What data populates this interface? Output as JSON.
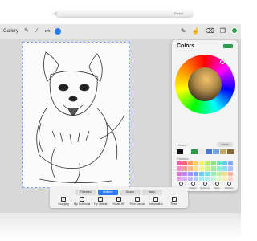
{
  "pencil": {
    "brand": "Pencil"
  },
  "topbar": {
    "gallery_label": "Gallery",
    "tools_left": [
      "wrench-icon",
      "magic-wand-icon",
      "selection-icon",
      "move-icon"
    ],
    "tools_right": [
      "brush-icon",
      "smudge-icon",
      "eraser-icon",
      "layers-icon"
    ],
    "current_color": "#2b9c4a"
  },
  "colors_panel": {
    "title": "Colors",
    "current_color": "#2b9c4a",
    "history_label": "History",
    "clear_label": "Clear",
    "history_colors": [
      "#111111",
      "#ffffff",
      "#2b9c4a",
      "#e8e8e8",
      "#4a78c9",
      "#6aa6e8",
      "#c8a860",
      "#8b6a3a"
    ],
    "palettes_label": "Palettes",
    "palette_colors": [
      "#ff5ca8",
      "#ff6b6b",
      "#ff9a5a",
      "#ffd15a",
      "#f5f55a",
      "#b8f05a",
      "#7ee87e",
      "#5ae8c0",
      "#5ad0f0",
      "#8aa8ff",
      "#ff8cc6",
      "#ff9a9a",
      "#ffb888",
      "#ffe088",
      "#f8f888",
      "#ccf488",
      "#a0f0a0",
      "#88f0d4",
      "#88e0f6",
      "#aabcff",
      "#e070e0",
      "#c080ff",
      "#a090ff",
      "#80a0ff",
      "#70c8ff",
      "#70e0e0",
      "#90f0b0",
      "#c0f090",
      "#f0e080",
      "#ffb0a0",
      "#f0a0f0",
      "#d8b0ff",
      "#c0b8ff",
      "#b0c8ff",
      "#a8e0ff",
      "#a8f0f0",
      "#c0f8d0",
      "#e0f8c0",
      "#f8f0b0",
      "#ffd0c8"
    ],
    "tabs": [
      "Disc",
      "Classic",
      "Harmony",
      "Value",
      "Palettes"
    ]
  },
  "bottom_toolbar": {
    "segments": [
      "Freeform",
      "Uniform",
      "Distort",
      "Warp"
    ],
    "active_segment": "Uniform",
    "actions": [
      "Snapping",
      "Flip Horizontal",
      "Flip Vertical",
      "Rotate 45°",
      "Fit to Canvas",
      "Interpolation",
      "Reset"
    ]
  },
  "canvas": {
    "subject": ""
  }
}
